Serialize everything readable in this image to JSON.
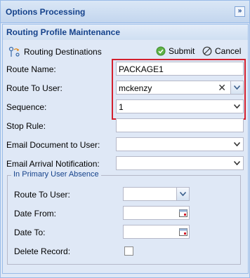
{
  "header": {
    "title": "Options Processing",
    "collapse_glyph": "»"
  },
  "subheader": {
    "title": "Routing Profile Maintenance"
  },
  "toolbar": {
    "routing_destinations": "Routing Destinations",
    "submit": "Submit",
    "cancel": "Cancel"
  },
  "form": {
    "route_name_label": "Route Name:",
    "route_name_value": "PACKAGE1",
    "route_to_user_label": "Route To User:",
    "route_to_user_value": "mckenzy",
    "sequence_label": "Sequence:",
    "sequence_value": "1",
    "stop_rule_label": "Stop Rule:",
    "email_document_label": "Email Document to User:",
    "email_arrival_label": "Email Arrival Notification:"
  },
  "absence": {
    "legend": "In Primary User Absence",
    "route_to_user_label": "Route To User:",
    "date_from_label": "Date From:",
    "date_to_label": "Date To:",
    "delete_record_label": "Delete Record:"
  },
  "colors": {
    "highlight": "#d4202e",
    "header_text": "#15428b"
  }
}
